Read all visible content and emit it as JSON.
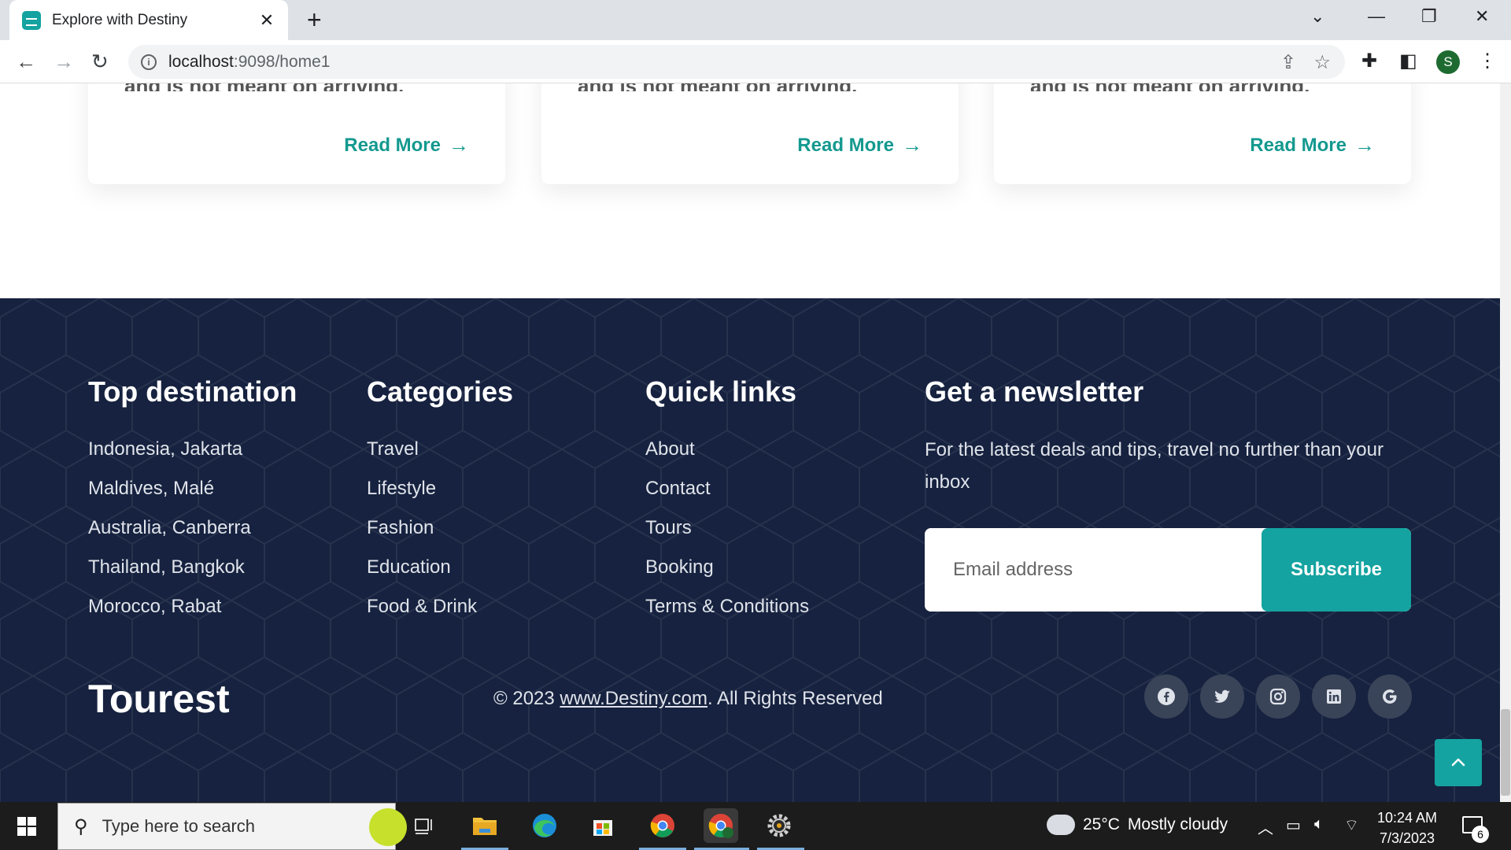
{
  "browser": {
    "tab_title": "Explore with Destiny",
    "tab_close": "✕",
    "new_tab": "+",
    "url_host": "localhost",
    "url_path": ":9098/home1",
    "profile_initial": "S"
  },
  "cards": [
    {
      "partial_text": "and is not meant on arriving.",
      "link": "Read More"
    },
    {
      "partial_text": "and is not meant on arriving.",
      "link": "Read More"
    },
    {
      "partial_text": "and is not meant on arriving.",
      "link": "Read More"
    }
  ],
  "footer": {
    "destinations": {
      "title": "Top destination",
      "items": [
        "Indonesia, Jakarta",
        "Maldives, Malé",
        "Australia, Canberra",
        "Thailand, Bangkok",
        "Morocco, Rabat"
      ]
    },
    "categories": {
      "title": "Categories",
      "items": [
        "Travel",
        "Lifestyle",
        "Fashion",
        "Education",
        "Food & Drink"
      ]
    },
    "quick_links": {
      "title": "Quick links",
      "items": [
        "About",
        "Contact",
        "Tours",
        "Booking",
        "Terms & Conditions"
      ]
    },
    "newsletter": {
      "title": "Get a newsletter",
      "text": "For the latest deals and tips, travel no further than your inbox",
      "email_placeholder": "Email address",
      "subscribe_label": "Subscribe"
    },
    "logo": "Tourest",
    "copyright_prefix": "© 2023 ",
    "copyright_link": "www.Destiny.com",
    "copyright_suffix": ". All Rights Reserved",
    "socials": [
      "facebook-icon",
      "twitter-icon",
      "instagram-icon",
      "linkedin-icon",
      "google-icon"
    ]
  },
  "taskbar": {
    "search_placeholder": "Type here to search",
    "weather_temp": "25°C",
    "weather_desc": "Mostly cloudy",
    "time": "10:24 AM",
    "date": "7/3/2023",
    "notification_count": "6"
  },
  "colors": {
    "accent": "#14a3a0",
    "footer_bg": "#16223f",
    "link_teal": "#14998f"
  }
}
